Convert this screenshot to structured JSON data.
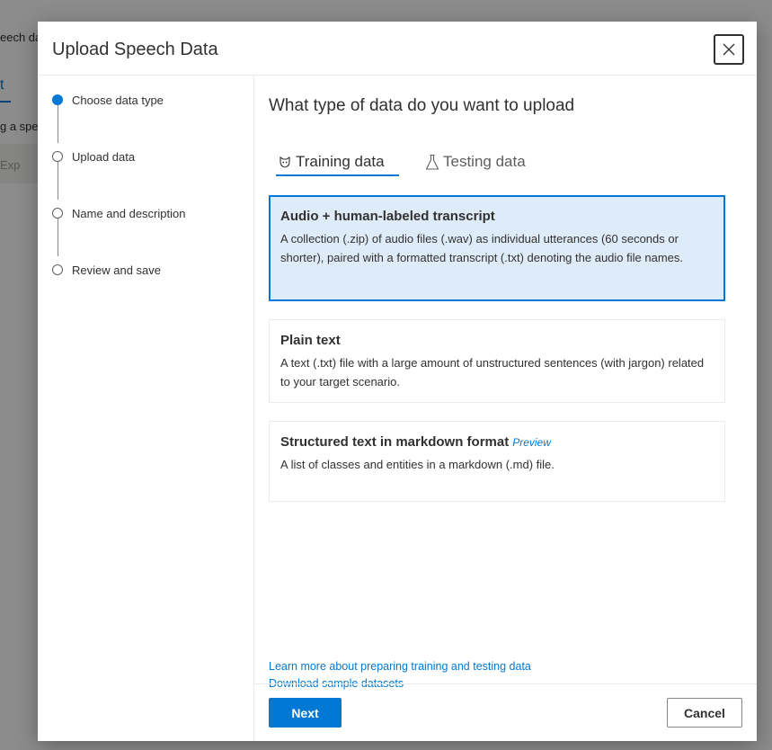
{
  "background": {
    "fragment_1": "eech da",
    "fragment_2": "t",
    "fragment_3": "g a spe",
    "fragment_4": "Exp"
  },
  "dialog": {
    "title": "Upload Speech Data",
    "close_icon": "close-icon"
  },
  "steps": [
    {
      "label": "Choose data type",
      "active": true
    },
    {
      "label": "Upload data",
      "active": false
    },
    {
      "label": "Name and description",
      "active": false
    },
    {
      "label": "Review and save",
      "active": false
    }
  ],
  "main": {
    "title": "What type of data do you want to upload",
    "tabs": [
      {
        "label": "Training data",
        "icon": "training-icon",
        "selected": true
      },
      {
        "label": "Testing data",
        "icon": "flask-icon",
        "selected": false
      }
    ],
    "options": [
      {
        "title": "Audio + human-labeled transcript",
        "description": "A collection (.zip) of audio files (.wav) as individual utterances (60 seconds or shorter), paired with a formatted transcript (.txt) denoting the audio file names.",
        "selected": true
      },
      {
        "title": "Plain text",
        "description": "A text (.txt) file with a large amount of unstructured sentences (with jargon) related to your target scenario.",
        "selected": false
      },
      {
        "title": "Structured text in markdown format",
        "badge": "Preview",
        "description": "A list of classes and entities in a markdown (.md) file.",
        "selected": false
      }
    ],
    "links": [
      "Learn more about preparing training and testing data",
      "Download sample datasets"
    ]
  },
  "footer": {
    "next_label": "Next",
    "cancel_label": "Cancel"
  },
  "colors": {
    "accent": "#0078d4",
    "selected_card_bg": "#deecf9"
  }
}
